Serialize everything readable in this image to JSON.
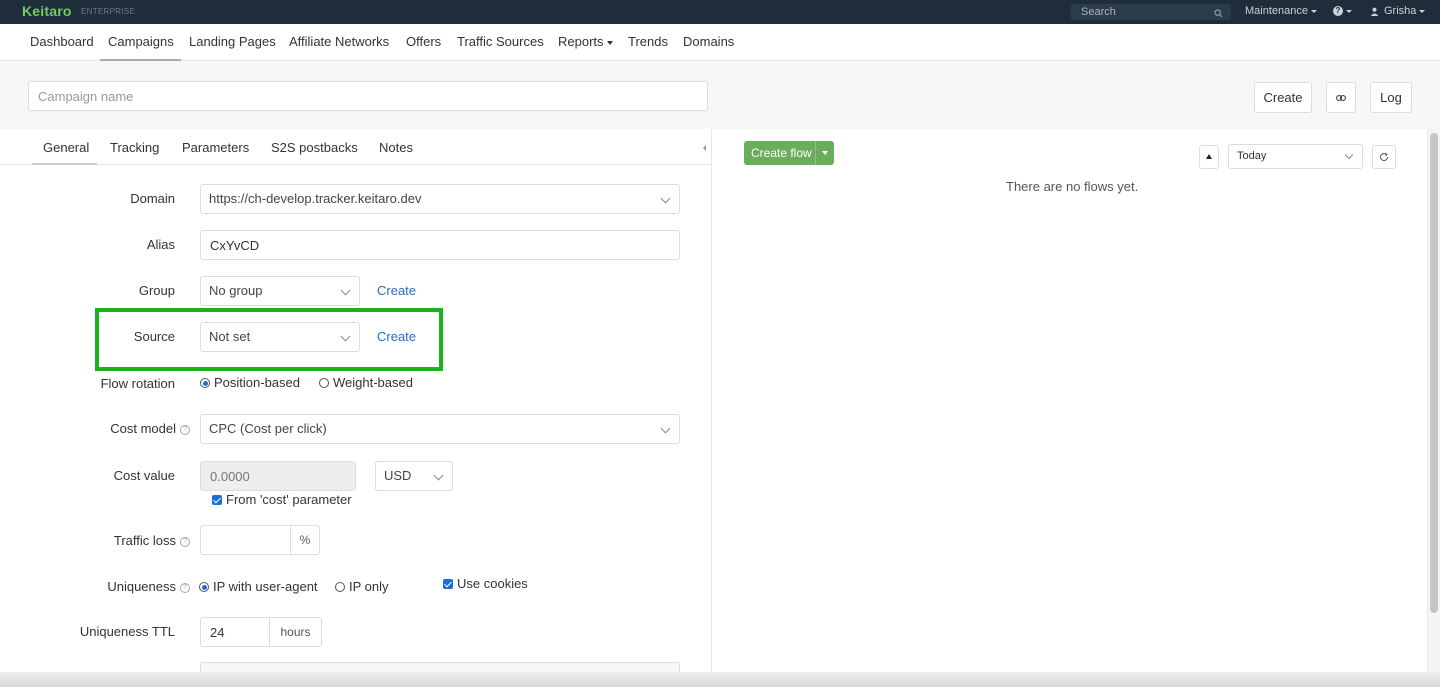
{
  "topbar": {
    "logo": "Keitaro",
    "logo_sub": "ENTERPRISE",
    "search_placeholder": "Search",
    "maintenance": "Maintenance",
    "help": "?",
    "user": "Grisha"
  },
  "nav": {
    "items": [
      "Dashboard",
      "Campaigns",
      "Landing Pages",
      "Affiliate Networks",
      "Offers",
      "Traffic Sources",
      "Reports",
      "Trends",
      "Domains"
    ],
    "active": "Campaigns"
  },
  "header": {
    "campaign_name_placeholder": "Campaign name",
    "create_label": "Create",
    "link_icon": "link-icon",
    "log_label": "Log"
  },
  "tabs": {
    "items": [
      "General",
      "Tracking",
      "Parameters",
      "S2S postbacks",
      "Notes"
    ],
    "active": "General"
  },
  "form": {
    "domain_label": "Domain",
    "domain_value": "https://ch-develop.tracker.keitaro.dev",
    "alias_label": "Alias",
    "alias_value": "CxYvCD",
    "group_label": "Group",
    "group_value": "No group",
    "group_create": "Create",
    "source_label": "Source",
    "source_value": "Not set",
    "source_create": "Create",
    "flow_rotation_label": "Flow rotation",
    "flow_rotation_opt1": "Position-based",
    "flow_rotation_opt2": "Weight-based",
    "cost_model_label": "Cost model",
    "cost_model_value": "CPC (Cost per click)",
    "cost_value_label": "Cost value",
    "cost_value_placeholder": "0.0000",
    "currency": "USD",
    "from_cost_param": "From 'cost' parameter",
    "traffic_loss_label": "Traffic loss",
    "traffic_loss_suffix": "%",
    "uniqueness_label": "Uniqueness",
    "uniqueness_opt1": "IP with user-agent",
    "uniqueness_opt2": "IP only",
    "use_cookies": "Use cookies",
    "uniqueness_ttl_label": "Uniqueness TTL",
    "uniqueness_ttl_value": "24",
    "uniqueness_ttl_suffix": "hours"
  },
  "flows": {
    "create_flow": "Create flow",
    "period": "Today",
    "empty_text": "There are no flows yet."
  },
  "colors": {
    "topbar": "#1f2d3a",
    "logo": "#6fcf64",
    "link": "#2a6ebb",
    "create_flow": "#6aae5d",
    "highlight": "#19b21d"
  }
}
